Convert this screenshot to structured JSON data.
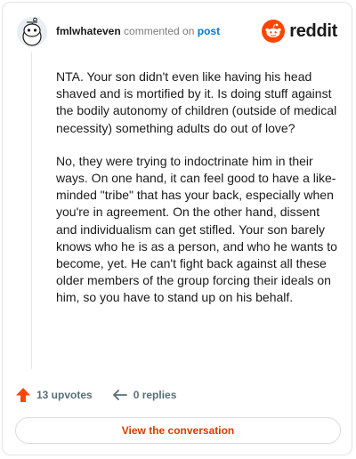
{
  "header": {
    "username": "fmlwhateven",
    "action_text": "commented on",
    "post_link": "post",
    "brand_name": "reddit"
  },
  "comment": {
    "paragraphs": [
      "NTA. Your son didn't even like having his head shaved and is mortified by it. Is doing stuff against the bodily autonomy of children (outside of medical necessity) something adults do out of love?",
      "No, they were trying to indoctrinate him in their ways. On one hand, it can feel good to have a like-minded \"tribe\" that has your back, especially when you're in agreement. On the other hand, dissent and individualism can get stifled. Your son barely knows who he is as a person, and who he wants to become, yet. He can't fight back against all these older members of the group forcing their ideals on him, so you have to stand up on his behalf."
    ]
  },
  "footer": {
    "upvotes_label": "13 upvotes",
    "replies_label": "0 replies",
    "cta_label": "View the conversation"
  },
  "colors": {
    "brand": "#ff4500",
    "link": "#0079d3",
    "cta_text": "#d93a00",
    "meta_gray": "#576f76"
  },
  "icons": {
    "avatar": "snoo-avatar-icon",
    "logo": "reddit-logo-icon",
    "upvote": "upvote-arrow-icon",
    "reply": "reply-arrow-icon"
  }
}
